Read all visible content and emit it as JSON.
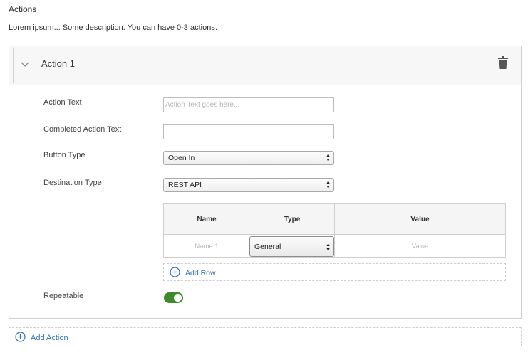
{
  "section": {
    "title": "Actions",
    "description": "Lorem ipsum... Some description. You can have 0-3 actions."
  },
  "action": {
    "title": "Action 1",
    "fields": {
      "action_text": {
        "label": "Action Text",
        "value": "",
        "placeholder": "Action Text goes here..."
      },
      "completed_text": {
        "label": "Completed Action Text",
        "value": "",
        "placeholder": ""
      },
      "button_type": {
        "label": "Button Type",
        "selected": "Open In"
      },
      "destination_type": {
        "label": "Destination Type",
        "selected": "REST API"
      }
    },
    "grid": {
      "columns": [
        "Name",
        "Type",
        "Value"
      ],
      "rows": [
        {
          "name_placeholder": "Name 1",
          "type": "General",
          "value_placeholder": "Value"
        }
      ],
      "add_row_label": "Add Row"
    },
    "repeatable": {
      "label": "Repeatable",
      "on": true
    }
  },
  "add_action_label": "Add Action",
  "colors": {
    "accent_link": "#2f73b5",
    "toggle_on": "#3d8a2d"
  },
  "icons": [
    "chevron-down-icon",
    "trash-icon",
    "plus-circle-icon",
    "select-arrows-icon"
  ]
}
